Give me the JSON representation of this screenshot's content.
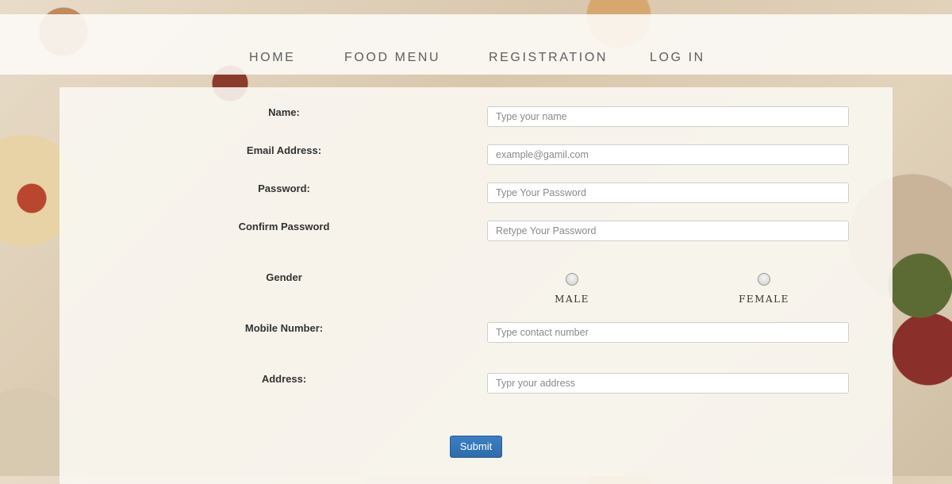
{
  "nav": {
    "items": [
      {
        "label": "HOME"
      },
      {
        "label": "FOOD MENU"
      },
      {
        "label": "REGISTRATION"
      },
      {
        "label": "LOG IN"
      }
    ]
  },
  "form": {
    "name": {
      "label": "Name:",
      "placeholder": "Type your name"
    },
    "email": {
      "label": "Email Address:",
      "placeholder": "example@gamil.com"
    },
    "password": {
      "label": "Password:",
      "placeholder": "Type Your Password"
    },
    "confirm_password": {
      "label": "Confirm Password",
      "placeholder": "Retype Your Password"
    },
    "gender": {
      "label": "Gender",
      "options": [
        {
          "label": "MALE"
        },
        {
          "label": "FEMALE"
        }
      ]
    },
    "mobile": {
      "label": "Mobile Number:",
      "placeholder": "Type contact number"
    },
    "address": {
      "label": "Address:",
      "placeholder": "Typr your address"
    },
    "submit_label": "Submit"
  }
}
